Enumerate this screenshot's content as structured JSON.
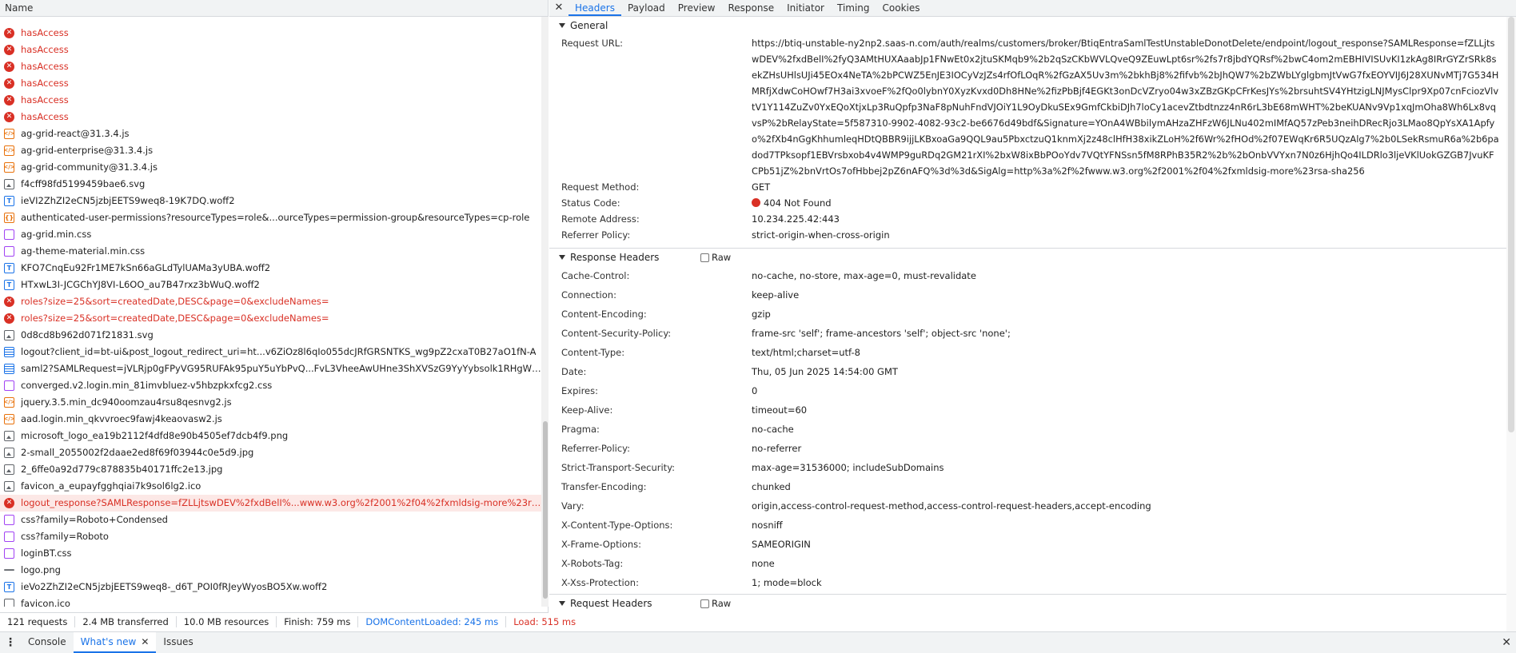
{
  "left": {
    "name_header": "Name",
    "requests": [
      {
        "name": "hasAccess",
        "type": "error",
        "state": "error"
      },
      {
        "name": "hasAccess",
        "type": "error",
        "state": "error"
      },
      {
        "name": "hasAccess",
        "type": "error",
        "state": "error"
      },
      {
        "name": "hasAccess",
        "type": "error",
        "state": "error"
      },
      {
        "name": "hasAccess",
        "type": "error",
        "state": "error"
      },
      {
        "name": "hasAccess",
        "type": "error",
        "state": "error"
      },
      {
        "name": "ag-grid-react@31.3.4.js",
        "type": "script",
        "state": "normal"
      },
      {
        "name": "ag-grid-enterprise@31.3.4.js",
        "type": "script",
        "state": "normal"
      },
      {
        "name": "ag-grid-community@31.3.4.js",
        "type": "script",
        "state": "normal"
      },
      {
        "name": "f4cff98fd5199459bae6.svg",
        "type": "image",
        "state": "normal"
      },
      {
        "name": "ieVI2ZhZI2eCN5jzbjEETS9weq8-19K7DQ.woff2",
        "type": "font",
        "state": "normal"
      },
      {
        "name": "authenticated-user-permissions?resourceTypes=role&...ourceTypes=permission-group&resourceTypes=cp-role",
        "type": "fetch",
        "state": "normal"
      },
      {
        "name": "ag-grid.min.css",
        "type": "css",
        "state": "normal"
      },
      {
        "name": "ag-theme-material.min.css",
        "type": "css",
        "state": "normal"
      },
      {
        "name": "KFO7CnqEu92Fr1ME7kSn66aGLdTylUAMa3yUBA.woff2",
        "type": "font",
        "state": "normal"
      },
      {
        "name": "HTxwL3I-JCGChYJ8VI-L6OO_au7B47rxz3bWuQ.woff2",
        "type": "font",
        "state": "normal"
      },
      {
        "name": "roles?size=25&sort=createdDate,DESC&page=0&excludeNames=",
        "type": "error",
        "state": "error"
      },
      {
        "name": "roles?size=25&sort=createdDate,DESC&page=0&excludeNames=",
        "type": "error",
        "state": "error"
      },
      {
        "name": "0d8cd8b962d071f21831.svg",
        "type": "image",
        "state": "normal"
      },
      {
        "name": "logout?client_id=bt-ui&post_logout_redirect_uri=ht...v6ZiOz8l6qIo055dcJRfGRSNTKS_wg9pZ2cxaT0B27aO1fN-A",
        "type": "document",
        "state": "normal"
      },
      {
        "name": "saml2?SAMLRequest=jVLRjp0gFPyVG95RUFAk95puY5uYbPvQ...FvL3VheeAwUHne3ShXVSzG9YyYybsolk1RHgW%2FYfQ%3...",
        "type": "document",
        "state": "normal"
      },
      {
        "name": "converged.v2.login.min_81imvbluez-v5hbzpkxfcg2.css",
        "type": "css",
        "state": "normal"
      },
      {
        "name": "jquery.3.5.min_dc940oomzau4rsu8qesnvg2.js",
        "type": "script",
        "state": "normal"
      },
      {
        "name": "aad.login.min_qkvvroec9fawj4keaovasw2.js",
        "type": "script",
        "state": "normal"
      },
      {
        "name": "microsoft_logo_ea19b2112f4dfd8e90b4505ef7dcb4f9.png",
        "type": "image",
        "state": "normal"
      },
      {
        "name": "2-small_2055002f2daae2ed8f69f03944c0e5d9.jpg",
        "type": "image",
        "state": "normal"
      },
      {
        "name": "2_6ffe0a92d779c878835b40171ffc2e13.jpg",
        "type": "image",
        "state": "normal"
      },
      {
        "name": "favicon_a_eupayfgghqiai7k9sol6lg2.ico",
        "type": "image",
        "state": "normal"
      },
      {
        "name": "logout_response?SAMLResponse=fZLLjtswDEV%2fxdBelI%...www.w3.org%2f2001%2f04%2fxmldsig-more%23rsa-sha256",
        "type": "error",
        "state": "selected"
      },
      {
        "name": "css?family=Roboto+Condensed",
        "type": "css",
        "state": "normal"
      },
      {
        "name": "css?family=Roboto",
        "type": "css",
        "state": "normal"
      },
      {
        "name": "loginBT.css",
        "type": "css",
        "state": "normal"
      },
      {
        "name": "logo.png",
        "type": "dash",
        "state": "normal"
      },
      {
        "name": "ieVo2ZhZI2eCN5jzbjEETS9weq8-_d6T_POI0fRJeyWyosBO5Xw.woff2",
        "type": "font",
        "state": "normal"
      },
      {
        "name": "favicon.ico",
        "type": "plain",
        "state": "normal"
      }
    ],
    "summary": {
      "requests": "121 requests",
      "transferred": "2.4 MB transferred",
      "resources": "10.0 MB resources",
      "finish": "Finish: 759 ms",
      "dcl": "DOMContentLoaded: 245 ms",
      "load": "Load: 515 ms"
    }
  },
  "right": {
    "close_glyph": "✕",
    "tabs": [
      "Headers",
      "Payload",
      "Preview",
      "Response",
      "Initiator",
      "Timing",
      "Cookies"
    ],
    "active_tab": "Headers",
    "general": {
      "title": "General",
      "request_url_label": "Request URL:",
      "request_url": "https://btiq-unstable-ny2np2.saas-n.com/auth/realms/customers/broker/BtiqEntraSamlTestUnstableDonotDelete/endpoint/logout_response?SAMLResponse=fZLLjtswDEV%2fxdBelI%2fyQ3AMtHUXAaabJp1FNwEt0x2jtuSKMqb9%2b2qSzCKbWVLQveQ9ZEuwLpt6sr%2fs7r8jbdYQRsf%2bwC4om2mEBHIVISUvKI1zkAg8IRrGYZrSRk8sekZHsUHlsUJi45EOx4NeTA%2bPCWZ5EnJE3IOCyVzJZs4rfOfLOqR%2fGzAX5Uv3m%2bkhBj8%2fifvb%2bJhQW7%2bZWbLYglgbmJtVwG7fxEOYVIJ6J28XUNvMTj7G534HMRfjXdwCoHOwf7H3ai3xvoeF%2fQo0lybnY0XyzKvxd0Dh8HNe%2fizPbBjf4EGKt3onDcVZryo04w3xZBzGKpCFrKesJYs%2brsuhtSV4YHtzigLNJMysClpr9Xp07cnFciozVlvtV1Y114ZuZv0YxEQoXtjxLp3RuQpfp3NaF8pNuhFndVJOiY1L9OyDkuSEx9GmfCkbiDJh7loCy1acevZtbdtnzz4nR6rL3bE68mWHT%2beKUANv9Vp1xqJmOha8Wh6Lx8vqvsP%2bRelayState=5f587310-9902-4082-93c2-be6676d49bdf&Signature=YOnA4WBbilymAHzaZHFzW6JLNu402mIMfAQ57zPeb3neihDRecRjo3LMao8QpYsXA1Apfyo%2fXb4nGgKhhumleqHDtQBBR9ijjLKBxoaGa9QQL9au5PbxctzuQ1knmXj2z48clHfH38xikZLoH%2f6Wr%2fHOd%2f07EWqKr6R5UQzAlg7%2b0LSekRsmuR6a%2b6padod7TPksopf1EBVrsbxob4v4WMP9guRDq2GM21rXI%2bxW8ixBbPOoYdv7VQtYFNSsn5fM8RPhB35R2%2b%2bOnbVVYxn7N0z6HjhQo4ILDRlo3ljeVKlUokGZGB7JvuKFCPb51jZ%2bnVrtOs7ofHbbej2pZ6nAFQ%3d%3d&SigAlg=http%3a%2f%2fwww.w3.org%2f2001%2f04%2fxmldsig-more%23rsa-sha256",
      "method_label": "Request Method:",
      "method": "GET",
      "status_label": "Status Code:",
      "status": "404 Not Found",
      "remote_label": "Remote Address:",
      "remote": "10.234.225.42:443",
      "referrer_label": "Referrer Policy:",
      "referrer": "strict-origin-when-cross-origin"
    },
    "response_headers": {
      "title": "Response Headers",
      "raw_label": "Raw",
      "items": [
        {
          "k": "Cache-Control:",
          "v": "no-cache, no-store, max-age=0, must-revalidate"
        },
        {
          "k": "Connection:",
          "v": "keep-alive"
        },
        {
          "k": "Content-Encoding:",
          "v": "gzip"
        },
        {
          "k": "Content-Security-Policy:",
          "v": "frame-src 'self'; frame-ancestors 'self'; object-src 'none';"
        },
        {
          "k": "Content-Type:",
          "v": "text/html;charset=utf-8"
        },
        {
          "k": "Date:",
          "v": "Thu, 05 Jun 2025 14:54:00 GMT"
        },
        {
          "k": "Expires:",
          "v": "0"
        },
        {
          "k": "Keep-Alive:",
          "v": "timeout=60"
        },
        {
          "k": "Pragma:",
          "v": "no-cache"
        },
        {
          "k": "Referrer-Policy:",
          "v": "no-referrer"
        },
        {
          "k": "Strict-Transport-Security:",
          "v": "max-age=31536000; includeSubDomains"
        },
        {
          "k": "Transfer-Encoding:",
          "v": "chunked"
        },
        {
          "k": "Vary:",
          "v": "origin,access-control-request-method,access-control-request-headers,accept-encoding"
        },
        {
          "k": "X-Content-Type-Options:",
          "v": "nosniff"
        },
        {
          "k": "X-Frame-Options:",
          "v": "SAMEORIGIN"
        },
        {
          "k": "X-Robots-Tag:",
          "v": "none"
        },
        {
          "k": "X-Xss-Protection:",
          "v": "1; mode=block"
        }
      ]
    },
    "request_headers": {
      "title": "Request Headers",
      "raw_label": "Raw"
    }
  },
  "drawer": {
    "menu_glyph": "⋮",
    "tabs": [
      "Console",
      "What's new",
      "Issues"
    ],
    "active_tab": "What's new",
    "tab_close_glyph": "✕",
    "close_glyph": "✕"
  },
  "colors": {
    "accent": "#1a73e8",
    "error": "#d93025",
    "selected_row": "#fce8e6"
  }
}
